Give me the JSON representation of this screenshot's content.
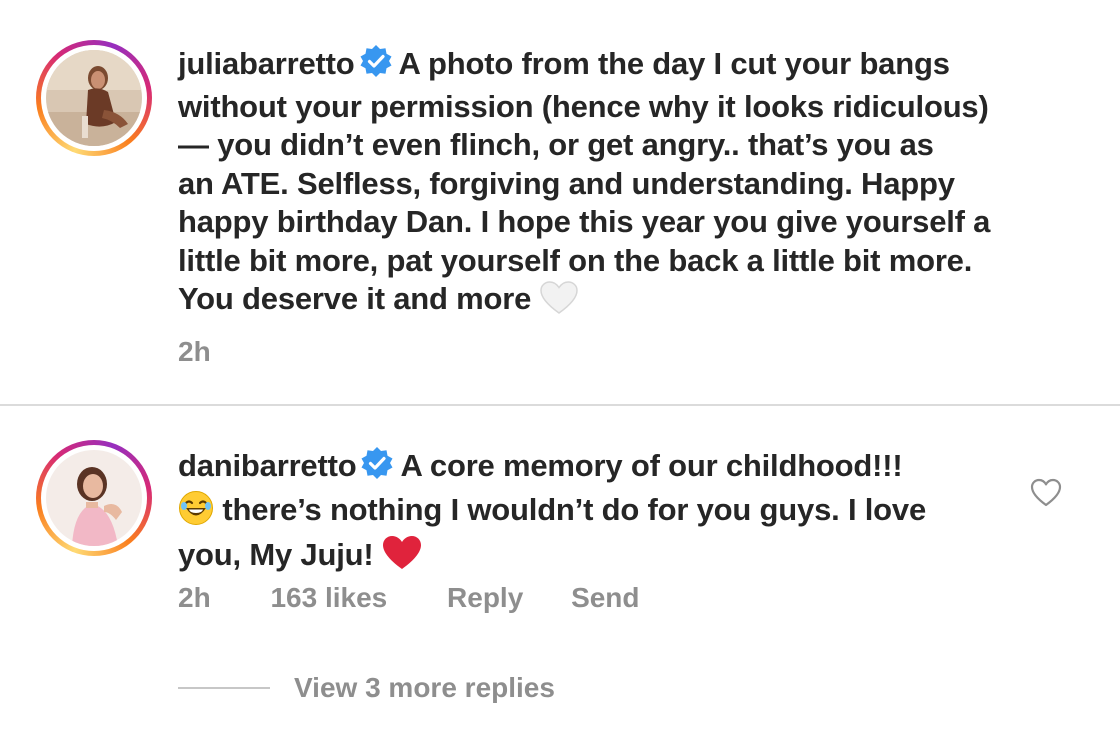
{
  "comments": [
    {
      "username": "juliabarretto",
      "verified": true,
      "text_lines": [
        "A photo from the day I cut your bangs",
        "without your permission (hence why it looks ridiculous)",
        "— you didn’t even flinch, or get angry.. that’s you as",
        "an ATE. Selfless, forgiving and understanding. Happy",
        "happy birthday Dan. I hope this year you give yourself a",
        "little bit more, pat yourself on the back a little bit more.",
        "You deserve it and more"
      ],
      "trailing_emoji": "white-heart-icon",
      "time": "2h"
    },
    {
      "username": "danibarretto",
      "verified": true,
      "text_lines": [
        "A core memory of our childhood!!!",
        "there’s nothing I wouldn’t do for you guys. I love",
        "you, My Juju!"
      ],
      "leading_emoji_line2": "laughing-face-icon",
      "trailing_emoji": "red-heart-icon",
      "time": "2h",
      "likes": "163 likes",
      "reply_label": "Reply",
      "send_label": "Send"
    }
  ],
  "view_replies": "View 3 more replies",
  "colors": {
    "text": "#262626",
    "meta": "#8e8e8e",
    "verified": "#3897f0",
    "divider": "#dbdbdb",
    "red_heart": "#e0233c"
  }
}
